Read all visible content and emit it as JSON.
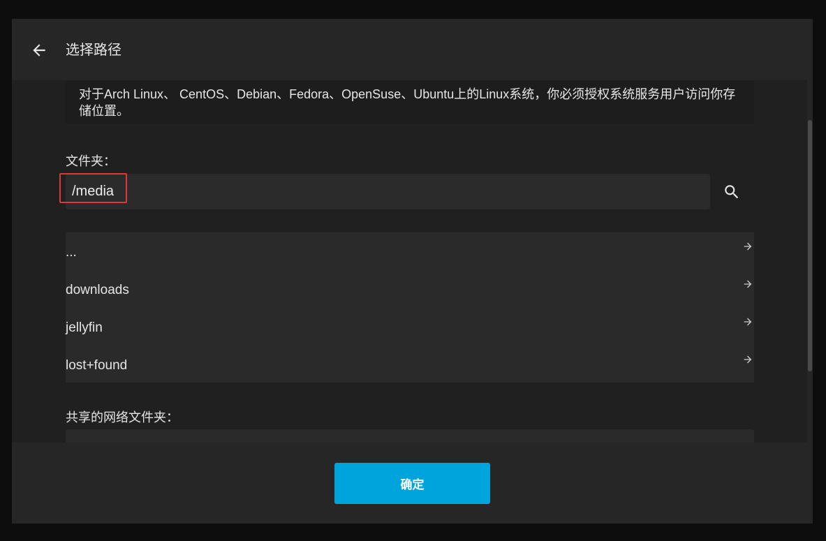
{
  "dialog": {
    "title": "选择路径",
    "back_icon": "arrow-left-icon"
  },
  "note": {
    "text": "对于Arch Linux、 CentOS、Debian、Fedora、OpenSuse、Ubuntu上的Linux系统，你必须授权系统服务用户访问你存储位置。"
  },
  "folder": {
    "label": "文件夹：",
    "value": "/media",
    "search_icon": "search-icon"
  },
  "directories": [
    {
      "name": "..."
    },
    {
      "name": "downloads"
    },
    {
      "name": "jellyfin"
    },
    {
      "name": "lost+found"
    }
  ],
  "network_share": {
    "label": "共享的网络文件夹："
  },
  "footer": {
    "ok_label": "确定"
  },
  "colors": {
    "accent": "#00a4dc",
    "highlight": "#e0383a"
  }
}
